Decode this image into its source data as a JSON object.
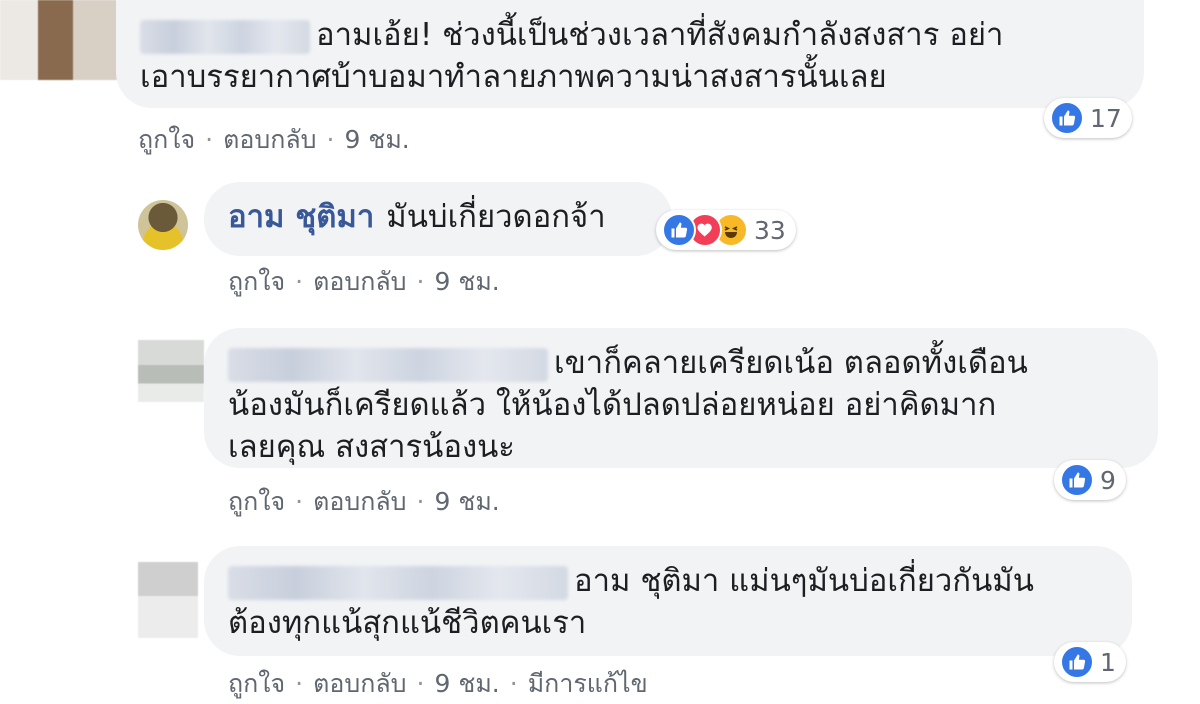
{
  "comments": [
    {
      "author_name": "",
      "text_lines": [
        "อามเอ้ย! ช่วงนี้เป็นช่วงเวลาที่สังคมกำลังสงสาร อย่า",
        "เอาบรรยากาศบ้าบอมาทำลายภาพความน่าสงสารนั้นเลย"
      ],
      "actions": {
        "like": "ถูกใจ",
        "reply": "ตอบกลับ",
        "time": "9 ชม."
      },
      "reaction_count": "17"
    },
    {
      "author_name": "อาม ชุติมา",
      "text_lines": [
        "มันบ่เกี่ยวดอกจ้า"
      ],
      "actions": {
        "like": "ถูกใจ",
        "reply": "ตอบกลับ",
        "time": "9 ชม."
      },
      "reaction_count": "33"
    },
    {
      "author_name": "",
      "text_lines": [
        "เขาก็คลายเครียดเน้อ ตลอดทั้งเดือน",
        "น้องมันก็เครียดแล้ว ให้น้องได้ปลดปล่อยหน่อย อย่าคิดมาก",
        "เลยคุณ สงสารน้องนะ"
      ],
      "actions": {
        "like": "ถูกใจ",
        "reply": "ตอบกลับ",
        "time": "9 ชม."
      },
      "reaction_count": "9"
    },
    {
      "author_name": "",
      "text_lines": [
        "อาม ชุติมา แม่นๆมันบ่อเกี่ยวกันมัน",
        "ต้องทุกแน้สุกแน้ชีวิตคนเรา"
      ],
      "actions": {
        "like": "ถูกใจ",
        "reply": "ตอบกลับ",
        "time": "9 ชม.",
        "edited": "มีการแก้ไข"
      },
      "reaction_count": "1"
    }
  ],
  "colors": {
    "bubble": "#f2f3f5",
    "like_blue": "#3578e5",
    "love_red": "#f33e58",
    "haha_yellow": "#f7b928",
    "name_link": "#385898",
    "meta_gray": "#606770"
  }
}
